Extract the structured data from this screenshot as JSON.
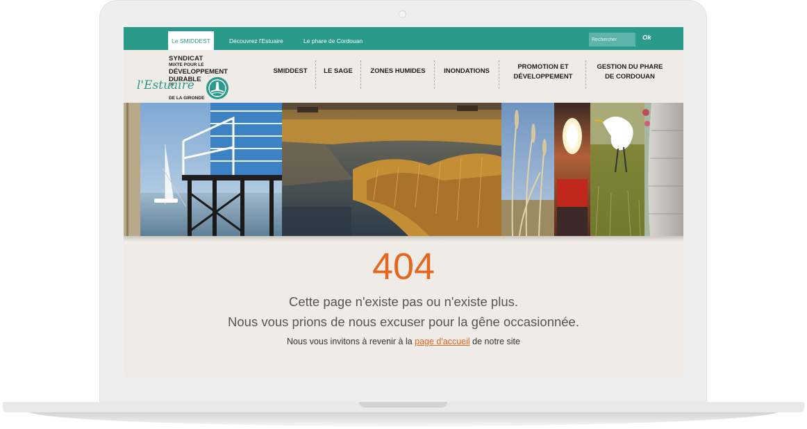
{
  "colors": {
    "brand_teal": "#2a9a8b",
    "accent_orange": "#e4661f",
    "page_background": "#efebe6",
    "laptop_frame": "#eeeeee"
  },
  "topbar": {
    "items": [
      {
        "label": "Le SMIDDEST",
        "active": true
      },
      {
        "label": "Découvrez l'Estuaire",
        "active": false
      },
      {
        "label": "Le phare de Cordouan",
        "active": false
      }
    ],
    "search": {
      "placeholder": "Rechercher",
      "button_label": "Ok"
    }
  },
  "logo": {
    "line1": "SYNDICAT",
    "line2": "MIXTE POUR LE",
    "line3": "DÉVELOPPEMENT",
    "line4": "DURABLE",
    "line5": "DE",
    "script": "l'Estuaire",
    "line6": "DE LA GIRONDE",
    "emblem_icon": "lighthouse-emblem-icon"
  },
  "mainnav": {
    "items": [
      {
        "line1": "SMIDDEST",
        "line2": ""
      },
      {
        "line1": "LE SAGE",
        "line2": ""
      },
      {
        "line1": "ZONES HUMIDES",
        "line2": ""
      },
      {
        "line1": "INONDATIONS",
        "line2": ""
      },
      {
        "line1": "PROMOTION ET",
        "line2": "DÉVELOPPEMENT"
      },
      {
        "line1": "GESTION DU PHARE",
        "line2": "DE CORDOUAN"
      }
    ]
  },
  "banner": {
    "panels": [
      "fishing-hut-photo",
      "marsh-reeds-photo",
      "grass-sky-photo",
      "lighthouse-lamp-photo",
      "egret-photo",
      "lighthouse-tower-photo"
    ]
  },
  "error": {
    "code": "404",
    "line1": "Cette page n'existe pas ou n'existe plus.",
    "line2": "Nous vous prions de nous excuser pour la gêne occasionnée.",
    "invite_before": "Nous vous invitons à revenir à la ",
    "invite_link": "page d'accueil",
    "invite_after": " de notre site"
  }
}
